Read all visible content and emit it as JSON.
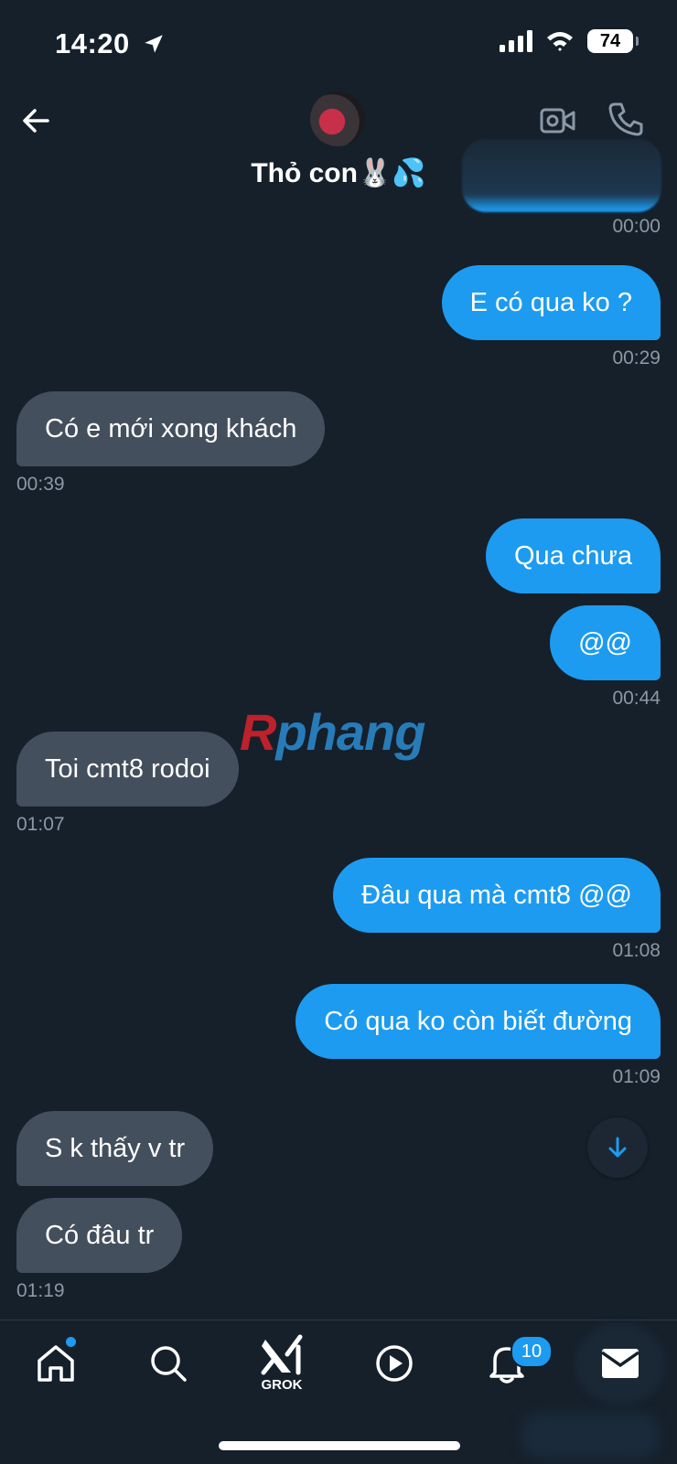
{
  "status_bar": {
    "time": "14:20",
    "battery": "74",
    "icons": [
      "location-arrow-icon",
      "signal-icon",
      "wifi-icon",
      "battery-icon"
    ]
  },
  "header": {
    "contact_name": "Thỏ con🐰💦",
    "icons": [
      "back-arrow-icon",
      "video-call-icon",
      "phone-icon"
    ]
  },
  "messages": [
    {
      "side": "sent",
      "text": "E có qua ko ?",
      "time": "00:29"
    },
    {
      "side": "received",
      "text": "Có e mới xong khách",
      "time": "00:39"
    },
    {
      "side": "sent",
      "text": "Qua chưa"
    },
    {
      "side": "sent",
      "text": "@@",
      "time": "00:44"
    },
    {
      "side": "received",
      "text": "Toi cmt8 rodoi",
      "time": "01:07"
    },
    {
      "side": "sent",
      "text": "Đâu qua mà cmt8 @@",
      "time": "01:08"
    },
    {
      "side": "sent",
      "text": "Có qua ko còn biết đường",
      "time": "01:09"
    },
    {
      "side": "received",
      "text": "S k thấy v tr"
    },
    {
      "side": "received",
      "text": "Có đâu tr",
      "time": "01:19"
    }
  ],
  "first_message_time": "00:00",
  "watermark": {
    "part1": "R",
    "part2": "phang"
  },
  "tabbar": {
    "grok_label": "GROK",
    "notifications_badge": "10",
    "tabs": [
      "home-icon",
      "search-icon",
      "grok-icon",
      "play-icon",
      "bell-icon",
      "mail-icon"
    ]
  },
  "colors": {
    "background": "#15202b",
    "sent_bubble": "#1d9bf0",
    "received_bubble": "#444f5d",
    "timestamp": "#8b98a5"
  }
}
